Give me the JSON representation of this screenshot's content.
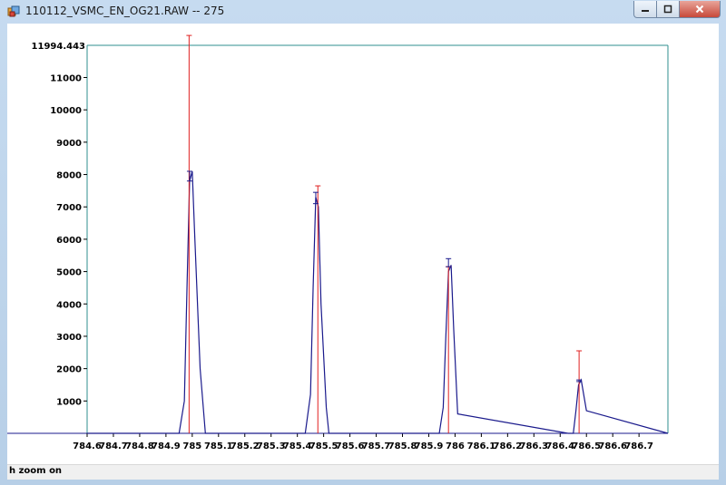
{
  "window": {
    "title": "110112_VSMC_EN_OG21.RAW -- 275",
    "controls": {
      "minimize_icon": "minimize-icon",
      "maximize_icon": "maximize-icon",
      "close_icon": "close-icon"
    }
  },
  "status_bar": {
    "text": "h zoom on"
  },
  "chart_data": {
    "type": "line",
    "title": "",
    "xlabel": "",
    "ylabel": "",
    "xlim": [
      784.6,
      786.81
    ],
    "ylim": [
      0,
      11994.443
    ],
    "y_top_label": "11994.443",
    "y_ticks": [
      1000,
      2000,
      3000,
      4000,
      5000,
      6000,
      7000,
      8000,
      9000,
      10000,
      11000
    ],
    "x_ticks": [
      "784.6",
      "784.7",
      "784.8",
      "784.9",
      "785",
      "785.1",
      "785.2",
      "785.3",
      "785.4",
      "785.5",
      "785.6",
      "785.7",
      "785.8",
      "785.9",
      "786",
      "786.1",
      "786.2",
      "786.3",
      "786.4",
      "786.5",
      "786.6",
      "786.7"
    ],
    "colors": {
      "profile": "#1a1a8c",
      "theoretical": "#e02020",
      "frame": "#2f8f8f"
    },
    "series": [
      {
        "type": "profile",
        "x": [
          784.6,
          784.95,
          784.97,
          784.98,
          784.99,
          785.0,
          785.01,
          785.03,
          785.05,
          785.43,
          785.45,
          785.46,
          785.47,
          785.48,
          785.49,
          785.51,
          785.52,
          785.94,
          785.955,
          785.965,
          785.975,
          785.985,
          785.995,
          786.01,
          786.43,
          786.45,
          786.46,
          786.47,
          786.48,
          786.5,
          786.81
        ],
        "y": [
          0,
          0,
          1000,
          4500,
          7800,
          8100,
          6000,
          2000,
          0,
          0,
          1200,
          4500,
          7300,
          7000,
          4000,
          800,
          0,
          0,
          800,
          3000,
          5000,
          5200,
          3200,
          600,
          0,
          0,
          700,
          1500,
          1650,
          700,
          0
        ]
      },
      {
        "type": "theoretical-stick",
        "x": [
          784.988,
          785.478,
          785.975,
          786.472
        ],
        "y": [
          12300,
          7650,
          5150,
          2550
        ]
      }
    ],
    "error_bars": [
      {
        "x": 784.99,
        "y_low": 7800,
        "y_high": 8100
      },
      {
        "x": 785.47,
        "y_low": 7100,
        "y_high": 7450
      },
      {
        "x": 785.975,
        "y_low": 5150,
        "y_high": 5400
      },
      {
        "x": 786.472,
        "y_low": 1600,
        "y_high": 1650
      }
    ]
  }
}
